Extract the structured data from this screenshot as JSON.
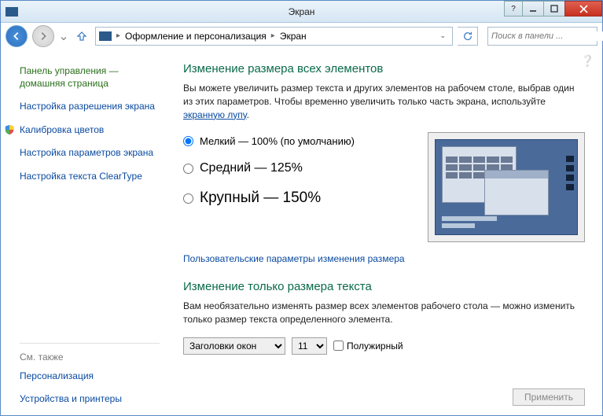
{
  "window": {
    "title": "Экран"
  },
  "breadcrumbs": {
    "item1": "Оформление и персонализация",
    "item2": "Экран"
  },
  "search": {
    "placeholder": "Поиск в панели ..."
  },
  "sidebar": {
    "home": "Панель управления — домашняя страница",
    "links": {
      "resolution": "Настройка разрешения экрана",
      "calibration": "Калибровка цветов",
      "params": "Настройка параметров экрана",
      "cleartype": "Настройка текста ClearType"
    },
    "footer_head": "См. также",
    "footer": {
      "personalization": "Персонализация",
      "devices": "Устройства и принтеры"
    }
  },
  "main": {
    "heading1": "Изменение размера всех элементов",
    "desc_pre": "Вы можете увеличить размер текста и других элементов на рабочем столе, выбрав один из этих параметров. Чтобы временно увеличить только часть экрана, используйте ",
    "desc_link": "экранную лупу",
    "desc_post": ".",
    "radios": {
      "small": "Мелкий — 100% (по умолчанию)",
      "medium": "Средний — 125%",
      "large": "Крупный — 150%"
    },
    "custom_link": "Пользовательские параметры изменения размера",
    "heading2": "Изменение только размера текста",
    "desc2": "Вам необязательно изменять размер всех элементов рабочего стола — можно изменить только размер текста определенного элемента.",
    "dropdown_element": "Заголовки окон",
    "dropdown_size": "11",
    "bold_label": "Полужирный",
    "apply": "Применить"
  }
}
